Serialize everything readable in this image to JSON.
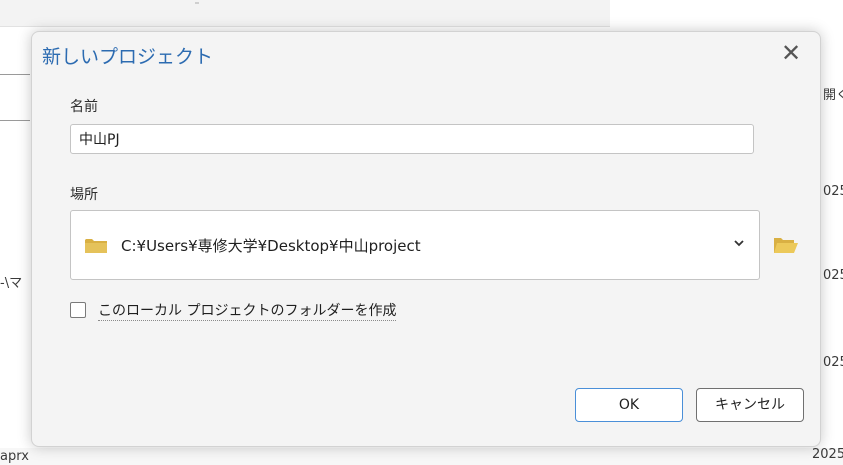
{
  "background": {
    "right_labels": [
      "開く",
      "025",
      "025",
      "025"
    ],
    "left_label": "-\\マ",
    "bottom_left": "aprx",
    "bottom_right": "2025"
  },
  "dialog": {
    "title": "新しいプロジェクト",
    "close_glyph": "✕",
    "name_label": "名前",
    "name_value": "中山PJ",
    "location_label": "場所",
    "location_value": "C:¥Users¥専修大学¥Desktop¥中山project",
    "checkbox_label": "このローカル プロジェクトのフォルダーを作成",
    "checkbox_checked": false,
    "ok_label": "OK",
    "cancel_label": "キャンセル"
  },
  "colors": {
    "title": "#2c6bb1",
    "folder": "#d9b043",
    "ok_border": "#4a8fd8"
  },
  "icons": {
    "folder": "folder-icon",
    "browse": "folder-open-icon",
    "dropdown": "chevron-down-icon",
    "close": "close-icon"
  }
}
